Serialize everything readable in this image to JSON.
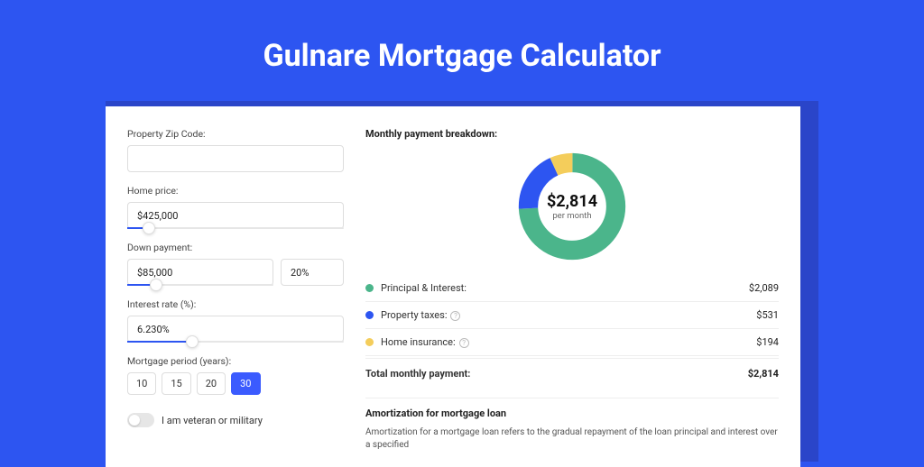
{
  "page_title": "Gulnare Mortgage Calculator",
  "form": {
    "zip_label": "Property Zip Code:",
    "zip_value": "",
    "home_price_label": "Home price:",
    "home_price_value": "$425,000",
    "home_price_slider_pct": 10,
    "down_payment_label": "Down payment:",
    "down_payment_value": "$85,000",
    "down_payment_pct": "20%",
    "down_payment_slider_pct": 20,
    "interest_label": "Interest rate (%):",
    "interest_value": "6.230%",
    "interest_slider_pct": 30,
    "period_label": "Mortgage period (years):",
    "period_options": [
      "10",
      "15",
      "20",
      "30"
    ],
    "period_active_index": 3,
    "veteran_label": "I am veteran or military",
    "veteran_on": false
  },
  "breakdown": {
    "title": "Monthly payment breakdown:",
    "center_value": "$2,814",
    "center_sub": "per month",
    "items": [
      {
        "label": "Principal & Interest:",
        "value": "$2,089",
        "color": "#4bb58b",
        "info": false
      },
      {
        "label": "Property taxes:",
        "value": "$531",
        "color": "#2d55f1",
        "info": true
      },
      {
        "label": "Home insurance:",
        "value": "$194",
        "color": "#f4cd5b",
        "info": true
      }
    ],
    "total_label": "Total monthly payment:",
    "total_value": "$2,814"
  },
  "amortization": {
    "title": "Amortization for mortgage loan",
    "body": "Amortization for a mortgage loan refers to the gradual repayment of the loan principal and interest over a specified"
  },
  "chart_data": {
    "type": "pie",
    "title": "Monthly payment breakdown",
    "series": [
      {
        "name": "Principal & Interest",
        "value": 2089,
        "color": "#4bb58b"
      },
      {
        "name": "Property taxes",
        "value": 531,
        "color": "#2d55f1"
      },
      {
        "name": "Home insurance",
        "value": 194,
        "color": "#f4cd5b"
      }
    ],
    "total": 2814
  }
}
